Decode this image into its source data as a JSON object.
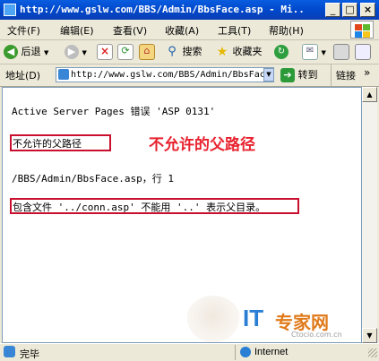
{
  "window": {
    "title": "http://www.gslw.com/BBS/Admin/BbsFace.asp - Mi...",
    "minimize": "_",
    "maximize": "□",
    "close": "×"
  },
  "menu": [
    "文件(F)",
    "编辑(E)",
    "查看(V)",
    "收藏(A)",
    "工具(T)",
    "帮助(H)"
  ],
  "toolbar": {
    "back": "后退",
    "search": "搜索",
    "favorites": "收藏夹"
  },
  "address": {
    "label": "地址(D)",
    "url": "http://www.gslw.com/BBS/Admin/BbsFac",
    "go": "转到",
    "links": "链接"
  },
  "page": {
    "error_heading": "Active Server Pages 错误 'ASP 0131'",
    "error_title": "不允许的父路径",
    "annotation": "不允许的父路径",
    "location": "/BBS/Admin/BbsFace.asp，行 1",
    "detail": "包含文件 '../conn.asp' 不能用 '..' 表示父目录。"
  },
  "watermark": {
    "logo_it": "IT",
    "logo_text": "专家网",
    "site": "Ctocio.com.cn"
  },
  "status": {
    "text": "完毕",
    "zone": "Internet"
  },
  "colors": {
    "title_blue": "#0048cc",
    "annotation_red": "#e8222e",
    "box_red": "#c8102e"
  }
}
